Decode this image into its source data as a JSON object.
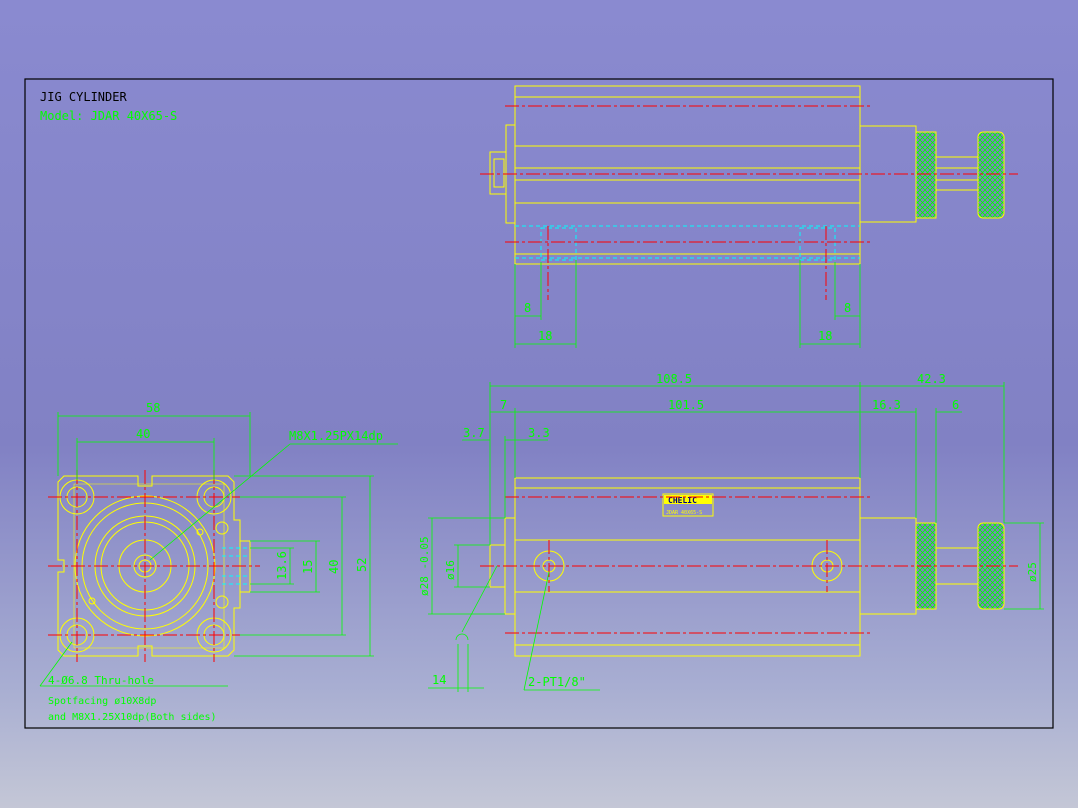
{
  "title": {
    "line1": "JIG CYLINDER",
    "line2": "Model:  JDAR  40X65-S"
  },
  "notes": {
    "holes": "4-Ø6.8  Thru-hole",
    "counterbore": "Spotfacing  ø10X8dp",
    "thread": "and M8X1.25X10dp(Both sides)",
    "tap": "M8X1.25PX14dp",
    "ports": "2-PT1/8\"",
    "logo": "CHELIC",
    "label_small": "JDAR 40X65-S"
  },
  "dimensions": {
    "top": [
      "8",
      "18",
      "18",
      "8"
    ],
    "front": [
      "58",
      "40",
      "52",
      "40",
      "15",
      "13.6"
    ],
    "side": [
      "108.5",
      "42.3",
      "7",
      "101.5",
      "16.3",
      "6",
      "3.7",
      "3.3",
      "14",
      "ø28 -0.05",
      "ø16",
      "ø25"
    ]
  },
  "colors": {
    "background": "#8181c4",
    "outline": "#ffff00",
    "dimension": "#00ff00",
    "centerline": "#ff0000",
    "hidden": "#00ffff",
    "border": "#000000",
    "title": "#000000"
  }
}
